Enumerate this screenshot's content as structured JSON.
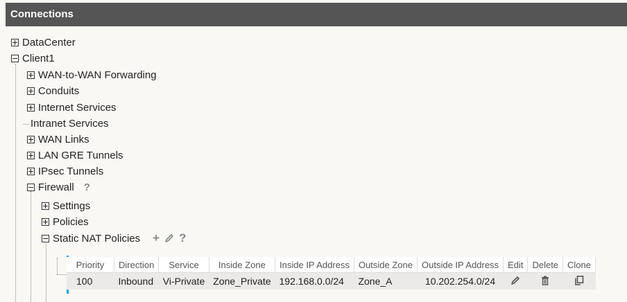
{
  "header": {
    "title": "Connections"
  },
  "tree": {
    "datacenter": "DataCenter",
    "client1": "Client1",
    "children": {
      "wan_to_wan": "WAN-to-WAN Forwarding",
      "conduits": "Conduits",
      "internet_services": "Internet Services",
      "intranet_services": "Intranet Services",
      "wan_links": "WAN Links",
      "lan_gre": "LAN GRE Tunnels",
      "ipsec": "IPsec Tunnels",
      "firewall": "Firewall"
    },
    "firewall_children": {
      "settings": "Settings",
      "policies": "Policies",
      "static_nat": "Static NAT Policies"
    },
    "help_glyph": "?",
    "add_glyph": "+"
  },
  "nat_table": {
    "columns": [
      "Priority",
      "Direction",
      "Service",
      "Inside Zone",
      "Inside IP Address",
      "Outside Zone",
      "Outside IP Address",
      "Edit",
      "Delete",
      "Clone"
    ],
    "rows": [
      {
        "priority": "100",
        "direction": "Inbound",
        "service": "Vi-Private",
        "inside_zone": "Zone_Private",
        "inside_ip": "192.168.0.0/24",
        "outside_zone": "Zone_A",
        "outside_ip": "10.202.254.0/24"
      }
    ]
  },
  "icons": {
    "edit": "pencil-icon",
    "delete": "trash-icon",
    "clone": "copy-icon",
    "help": "help-icon",
    "add": "plus-icon"
  },
  "colors": {
    "header_bg": "#555555",
    "accent": "#1ba5e0"
  }
}
